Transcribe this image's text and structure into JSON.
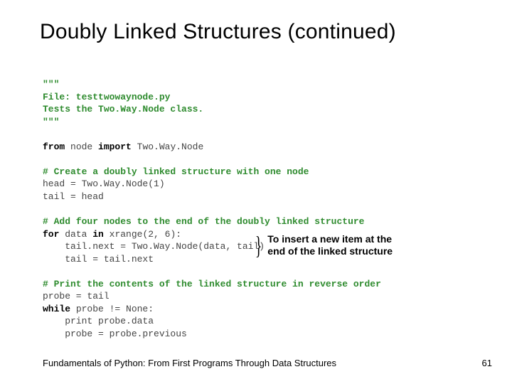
{
  "title": "Doubly Linked Structures (continued)",
  "code": {
    "l1": "\"\"\"",
    "l2": "File: testtwowaynode.py",
    "l3": "Tests the Two.Way.Node class.",
    "l4": "\"\"\"",
    "l5a": "from ",
    "l5b": "node ",
    "l5c": "import ",
    "l5d": "Two.Way.Node",
    "l6": "# Create a doubly linked structure with one node",
    "l7": "head = Two.Way.Node(1)",
    "l8": "tail = head",
    "l9": "# Add four nodes to the end of the doubly linked structure",
    "l10a": "for ",
    "l10b": "data ",
    "l10c": "in ",
    "l10d": "xrange(2, 6):",
    "l11": "    tail.next = Two.Way.Node(data, tail)",
    "l12": "    tail = tail.next",
    "l13": "# Print the contents of the linked structure in reverse order",
    "l14": "probe = tail",
    "l15a": "while ",
    "l15b": "probe != None:",
    "l16": "    print probe.data",
    "l17": "    probe = probe.previous"
  },
  "annotation": {
    "line1": "To insert a new item at the",
    "line2": "end of the linked structure"
  },
  "footer": "Fundamentals of Python: From First Programs Through Data Structures",
  "page": "61"
}
